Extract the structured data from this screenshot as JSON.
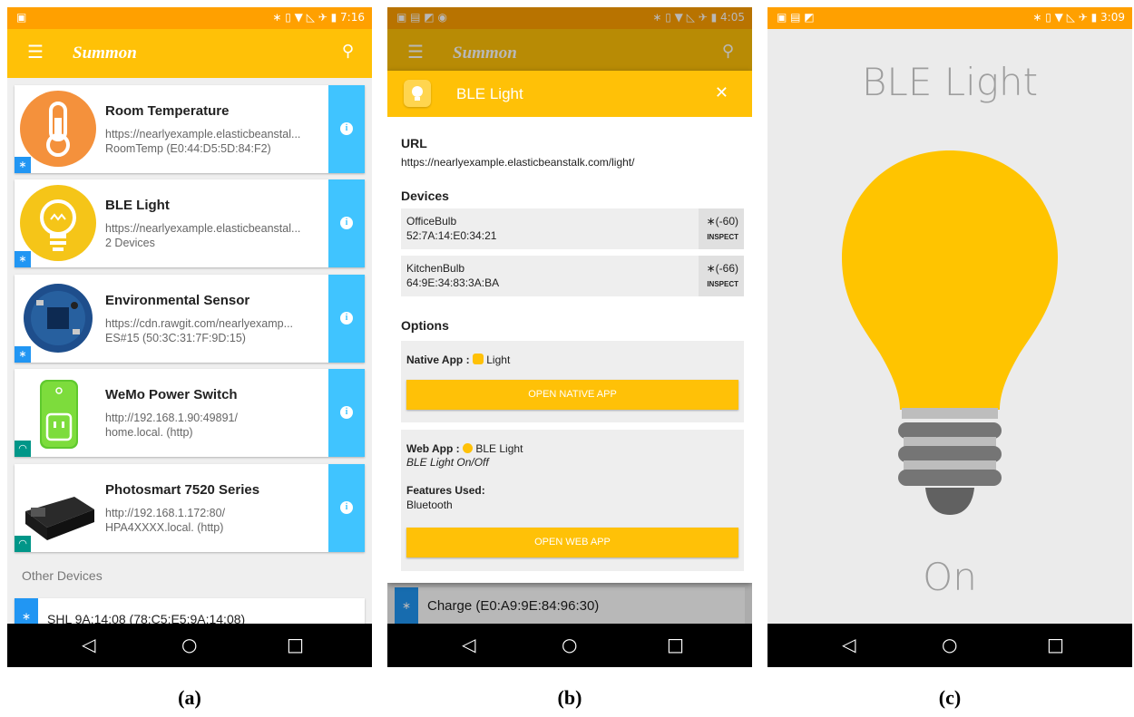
{
  "panel_a": {
    "status_time": "7:16",
    "app_title": "Summon",
    "cards": [
      {
        "title": "Room Temperature",
        "line1": "https://nearlyexample.elasticbeanstal...",
        "line2": "RoomTemp (E0:44:D5:5D:84:F2)"
      },
      {
        "title": "BLE Light",
        "line1": "https://nearlyexample.elasticbeanstal...",
        "line2": "2 Devices"
      },
      {
        "title": "Environmental Sensor",
        "line1": "https://cdn.rawgit.com/nearlyexamp...",
        "line2": "ES#15 (50:3C:31:7F:9D:15)"
      },
      {
        "title": "WeMo Power Switch",
        "line1": "http://192.168.1.90:49891/",
        "line2": "home.local. (http)"
      },
      {
        "title": "Photosmart 7520 Series",
        "line1": "http://192.168.1.172:80/",
        "line2": "HPA4XXXX.local. (http)"
      }
    ],
    "other_devices_label": "Other Devices",
    "other_device": "SHL 9A:14:08 (78:C5:E5:9A:14:08)"
  },
  "panel_b": {
    "status_time": "4:05",
    "app_title": "Summon",
    "dialog_title": "BLE Light",
    "url_label": "URL",
    "url": "https://nearlyexample.elasticbeanstalk.com/light/",
    "devices_label": "Devices",
    "devices": [
      {
        "name": "OfficeBulb",
        "address": "52:7A:14:E0:34:21",
        "rssi": "(-60)",
        "inspect": "INSPECT"
      },
      {
        "name": "KitchenBulb",
        "address": "64:9E:34:83:3A:BA",
        "rssi": "(-66)",
        "inspect": "INSPECT"
      }
    ],
    "options_label": "Options",
    "native_app_label": "Native App :",
    "native_app_name": "Light",
    "open_native_label": "OPEN NATIVE APP",
    "web_app_label": "Web App :",
    "web_app_name": "BLE Light",
    "web_app_desc": "BLE Light On/Off",
    "features_label": "Features Used:",
    "features": "Bluetooth",
    "open_web_label": "OPEN WEB APP",
    "behind_item": "Charge (E0:A9:9E:84:96:30)"
  },
  "panel_c": {
    "status_time": "3:09",
    "title": "BLE Light",
    "state": "On"
  },
  "captions": [
    "(a)",
    "(b)",
    "(c)"
  ],
  "colors": {
    "accent": "#ffc107",
    "info": "#40c4ff",
    "ble_badge": "#2196f3",
    "wifi_badge": "#009688"
  }
}
